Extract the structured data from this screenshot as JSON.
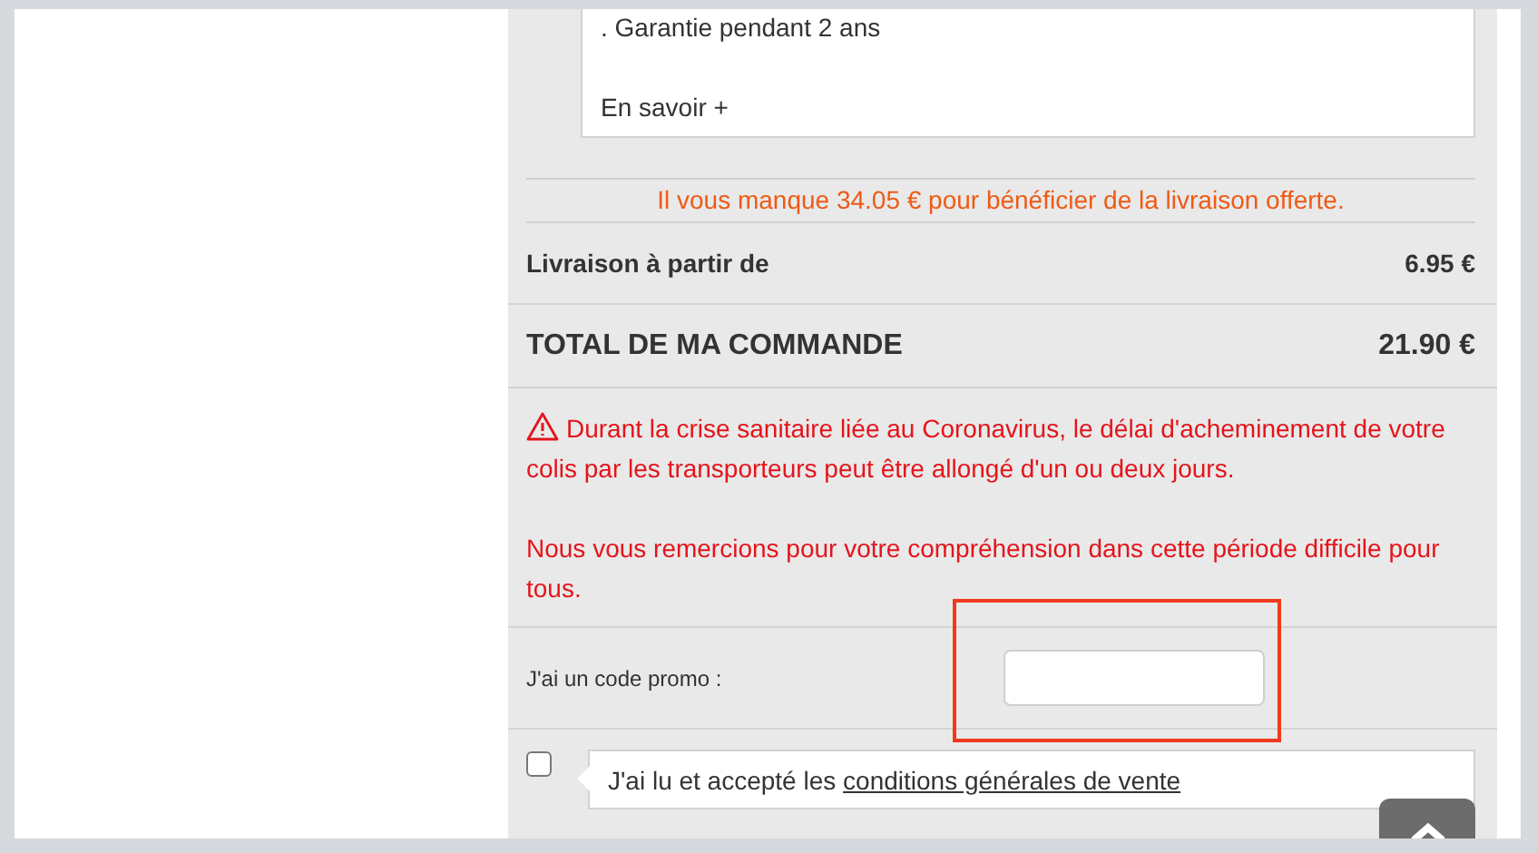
{
  "product_info": {
    "lines": [
      ". Garantie pendant 2 ans",
      "En savoir +"
    ]
  },
  "shipping_notice": "Il vous manque 34.05 € pour bénéficier de la livraison offerte.",
  "summary": [
    {
      "kind": "delivery",
      "label": "Livraison à partir de",
      "value": "6.95 €"
    },
    {
      "kind": "total",
      "label": "TOTAL DE MA COMMANDE",
      "value": "21.90 €"
    }
  ],
  "warning": [
    "Durant la crise sanitaire liée au Coronavirus, le délai d'acheminement de votre colis par les transporteurs peut être allongé d'un ou deux jours.",
    "Nous vous remercions pour votre compréhension dans cette période difficile pour tous."
  ],
  "promo": {
    "label": "J'ai un code promo :",
    "highlighted": true
  },
  "terms": {
    "text": "J'ai lu et accepté les",
    "link": "conditions générales de vente",
    "checked": false
  }
}
